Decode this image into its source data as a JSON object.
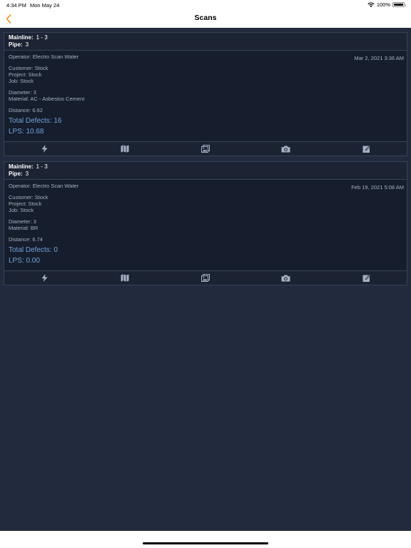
{
  "status": {
    "time": "4:34 PM",
    "date": "Mon May 24",
    "battery": "100%",
    "battery_level": 1.0
  },
  "nav": {
    "title": "Scans",
    "back_icon": "chevron-left-icon",
    "accent": "#f0a020"
  },
  "scans": [
    {
      "mainline_label": "Mainline:",
      "mainline": "1 - 3",
      "pipe_label": "Pipe:",
      "pipe": "3",
      "operator": "Operator: Electro Scan Water",
      "date": "Mar 2, 2021 3:36 AM",
      "customer": "Customer: Stock",
      "project": "Project: Stock",
      "job": "Job: Stock",
      "diameter": "Diameter: 3",
      "material": "Material: AC - Asbestos Cement",
      "distance": "Distance: 6.62",
      "total_defects": "Total Defects: 16",
      "lps": "LPS: 10.68"
    },
    {
      "mainline_label": "Mainline:",
      "mainline": "1 - 3",
      "pipe_label": "Pipe:",
      "pipe": "3",
      "operator": "Operator: Electro Scan Water",
      "date": "Feb 19, 2021 5:08 AM",
      "customer": "Customer: Stock",
      "project": "Project: Stock",
      "job": "Job: Stock",
      "diameter": "Diameter: 3",
      "material": "Material: BR",
      "distance": "Distance: 6.74",
      "total_defects": "Total Defects: 0",
      "lps": "LPS: 0.00"
    }
  ],
  "actions": [
    "bolt-icon",
    "map-icon",
    "image-icon",
    "camera-icon",
    "edit-icon"
  ],
  "colors": {
    "background": "#222b3d",
    "card": "#161d2c",
    "link": "#6fa3dd",
    "text": "#a5b0c3"
  }
}
